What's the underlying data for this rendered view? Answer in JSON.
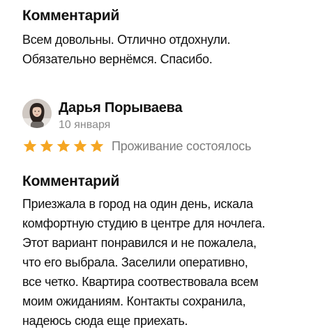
{
  "previous_review": {
    "heading": "Комментарий",
    "lines": [
      "Всем довольны. Отлично отдохнули.",
      "Обязательно вернёмся. Спасибо."
    ]
  },
  "review": {
    "author_name": "Дарья Порываева",
    "date": "10 января",
    "rating": 5,
    "rating_max": 5,
    "star_color": "#f5a623",
    "stay_status": "Проживание состоялось",
    "heading": "Комментарий",
    "lines": [
      "Приезжала в город на один день, искала",
      "комфортную студию в центре для ночлега.",
      "Этот вариант понравился и не пожалела,",
      "что его выбрала. Заселили оперативно,",
      "все четко. Квартира соотвествовала всем",
      "моим ожиданиям. Контакты сохранила,",
      "надеюсь сюда еще приехать."
    ]
  },
  "icons": {
    "star": "star-icon",
    "avatar": "user-avatar-photo"
  }
}
